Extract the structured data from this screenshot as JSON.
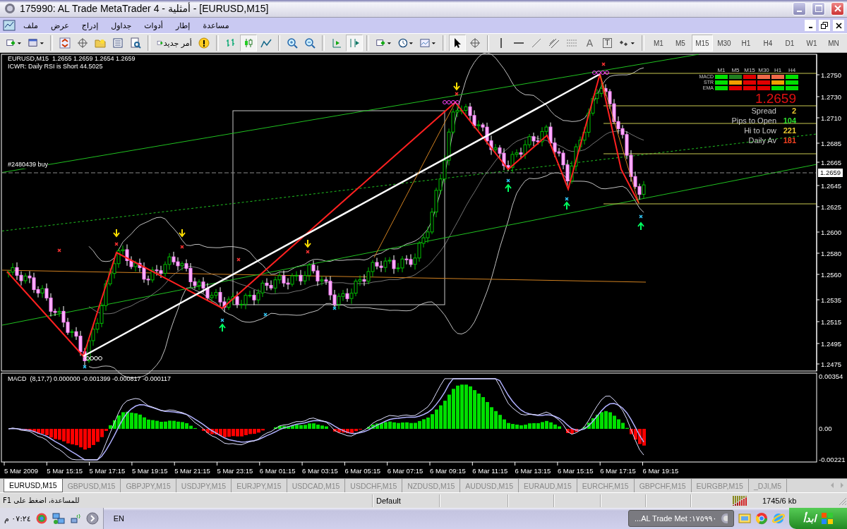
{
  "window": {
    "title": "175990: AL Trade MetaTrader 4 - أمثلية - [EURUSD,M15]"
  },
  "menu": [
    "مساعدة",
    "إطار",
    "أدوات",
    "جداول",
    "إدراج",
    "عرض",
    "ملف"
  ],
  "toolbar": {
    "new_order": "أمر جديد",
    "text_tool": "A",
    "label_tool": "T",
    "timeframes": [
      {
        "label": "M1",
        "selected": false
      },
      {
        "label": "M5",
        "selected": false
      },
      {
        "label": "M15",
        "selected": true
      },
      {
        "label": "M30",
        "selected": false
      },
      {
        "label": "H1",
        "selected": false
      },
      {
        "label": "H4",
        "selected": false
      },
      {
        "label": "D1",
        "selected": false
      },
      {
        "label": "W1",
        "selected": false
      },
      {
        "label": "MN",
        "selected": false
      }
    ]
  },
  "chart": {
    "header": [
      "EURUSD,M15  1.2655 1.2659 1.2654 1.2659",
      "ICWR: Daily RSI is Short 44.5025"
    ],
    "order_label": "#2480439 buy",
    "price_axis": [
      "1.2750",
      "1.2730",
      "1.2710",
      "1.2685",
      "1.2665",
      "1.2645",
      "1.2625",
      "1.2600",
      "1.2580",
      "1.2560",
      "1.2535",
      "1.2515",
      "1.2495",
      "1.2475"
    ],
    "current_price": "1.2659",
    "signal_table": {
      "columns": [
        "M1",
        "M5",
        "M15",
        "M30",
        "H1",
        "H4"
      ],
      "rows": [
        {
          "label": "MACD",
          "cells": [
            {
              "color": "#00e000"
            },
            {
              "color": "#208020"
            },
            {
              "color": "#e00000"
            },
            {
              "color": "#f06848"
            },
            {
              "color": "#f06848"
            },
            {
              "color": "#00e000"
            }
          ]
        },
        {
          "label": "STR",
          "cells": [
            {
              "color": "#00e000"
            },
            {
              "color": "#f0a000"
            },
            {
              "color": "#e00000"
            },
            {
              "color": "#e00000"
            },
            {
              "color": "#f0a000"
            },
            {
              "color": "#00e000"
            }
          ]
        },
        {
          "label": "EMA",
          "cells": [
            {
              "color": "#00e000"
            },
            {
              "color": "#e00000"
            },
            {
              "color": "#e00000"
            },
            {
              "color": "#e00000"
            },
            {
              "color": "#00e000"
            },
            {
              "color": "#00e000"
            }
          ]
        }
      ]
    },
    "big_price": "1.2659",
    "stats": [
      {
        "label": "Spread",
        "value": "2",
        "color": "#e8c830"
      },
      {
        "label": "Pips to Open",
        "value": "104",
        "color": "#30e030"
      },
      {
        "label": "Hi to Low",
        "value": "221",
        "color": "#e8c830"
      },
      {
        "label": "Daily Av",
        "value": "181",
        "color": "#f04020"
      }
    ]
  },
  "macd": {
    "header": "MACD  (8,17,7) 0.000000 -0.001399 -0.000817 -0.000117",
    "axis": [
      "0.00354",
      "0.00",
      "-0.00221"
    ]
  },
  "time_axis": [
    "5 Mar 2009",
    "5 Mar 15:15",
    "5 Mar 17:15",
    "5 Mar 19:15",
    "5 Mar 21:15",
    "5 Mar 23:15",
    "6 Mar 01:15",
    "6 Mar 03:15",
    "6 Mar 05:15",
    "6 Mar 07:15",
    "6 Mar 09:15",
    "6 Mar 11:15",
    "6 Mar 13:15",
    "6 Mar 15:15",
    "6 Mar 17:15",
    "6 Mar 19:15"
  ],
  "tabs": [
    {
      "label": "EURUSD,M15",
      "selected": true
    },
    {
      "label": "GBPUSD,M15",
      "selected": false
    },
    {
      "label": "GBPJPY,M15",
      "selected": false
    },
    {
      "label": "USDJPY,M15",
      "selected": false
    },
    {
      "label": "EURJPY,M15",
      "selected": false
    },
    {
      "label": "USDCAD,M15",
      "selected": false
    },
    {
      "label": "USDCHF,M15",
      "selected": false
    },
    {
      "label": "NZDUSD,M15",
      "selected": false
    },
    {
      "label": "AUDUSD,M15",
      "selected": false
    },
    {
      "label": "EURAUD,M15",
      "selected": false
    },
    {
      "label": "EURCHF,M15",
      "selected": false
    },
    {
      "label": "GBPCHF,M15",
      "selected": false
    },
    {
      "label": "EURGBP,M15",
      "selected": false
    },
    {
      "label": "_DJI,M5",
      "selected": false
    }
  ],
  "status_bar": {
    "help": "للمساعدة، اضغط على F1",
    "profile": "Default",
    "traffic": "1745/6 kb"
  },
  "taskbar": {
    "clock": "٠٧:٢٤ م",
    "language": "EN",
    "task": "١٧٥٩٩٠: AL Trade Met...",
    "start": "ابدأ"
  }
}
